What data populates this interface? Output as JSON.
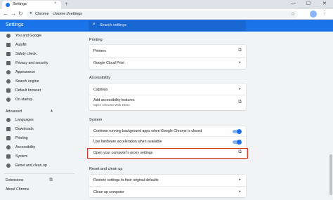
{
  "browser": {
    "tab_title": "Settings",
    "tab_close": "×",
    "new_tab": "+",
    "win_min": "—",
    "win_max": "☐",
    "win_close": "✕",
    "back": "←",
    "forward": "→",
    "reload": "↻",
    "omnibox_label": "Chrome",
    "omnibox_url": "chrome://settings",
    "star": "☆",
    "menu": "⋮"
  },
  "header": {
    "title": "Settings",
    "search_placeholder": "Search settings",
    "search_icon": "⌕"
  },
  "sidebar": {
    "items": [
      {
        "label": "You and Google",
        "icon": "person-icon"
      },
      {
        "label": "Autofill",
        "icon": "autofill-icon"
      },
      {
        "label": "Safety check",
        "icon": "shield-icon"
      },
      {
        "label": "Privacy and security",
        "icon": "shield-lock-icon"
      },
      {
        "label": "Appearance",
        "icon": "palette-icon"
      },
      {
        "label": "Search engine",
        "icon": "search-icon"
      },
      {
        "label": "Default browser",
        "icon": "browser-icon"
      },
      {
        "label": "On startup",
        "icon": "power-icon"
      }
    ],
    "advanced": "Advanced",
    "advanced_caret": "▴",
    "advanced_items": [
      {
        "label": "Languages",
        "icon": "globe-icon"
      },
      {
        "label": "Downloads",
        "icon": "download-icon"
      },
      {
        "label": "Printing",
        "icon": "printer-icon"
      },
      {
        "label": "Accessibility",
        "icon": "accessibility-icon"
      },
      {
        "label": "System",
        "icon": "wrench-icon"
      },
      {
        "label": "Reset and clean up",
        "icon": "reset-icon"
      }
    ],
    "extensions": "Extensions",
    "extensions_icon": "⧉",
    "about": "About Chrome"
  },
  "main": {
    "printing": {
      "title": "Printing",
      "rows": [
        "Printers",
        "Google Cloud Print"
      ]
    },
    "accessibility": {
      "title": "Accessibility",
      "captions": "Captions",
      "add_features": "Add accessibility features",
      "add_features_sub": "Open Chrome Web Store"
    },
    "system": {
      "title": "System",
      "bg_apps": "Continue running background apps when Google Chrome is closed",
      "hw_accel": "Use hardware acceleration when available",
      "proxy": "Open your computer's proxy settings"
    },
    "reset": {
      "title": "Reset and clean up",
      "restore": "Restore settings to their original defaults",
      "cleanup": "Clean up computer"
    },
    "ext_icon": "⧉",
    "arrow": "▸"
  },
  "toggles": {
    "bg_apps_on": true,
    "hw_accel_on": true
  }
}
